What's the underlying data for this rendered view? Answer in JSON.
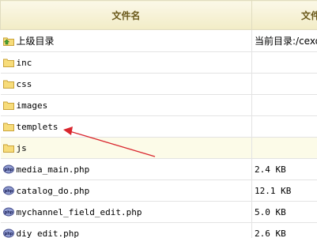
{
  "header": {
    "name_col": "文件名",
    "second_col": "文件"
  },
  "parent_row": {
    "label": "上级目录",
    "current_dir": "当前目录:/cexo"
  },
  "folders": [
    {
      "name": "inc"
    },
    {
      "name": "css"
    },
    {
      "name": "images"
    },
    {
      "name": "templets"
    },
    {
      "name": "js"
    }
  ],
  "files": [
    {
      "name": "media_main.php",
      "size": "2.4 KB"
    },
    {
      "name": "catalog_do.php",
      "size": "12.1 KB"
    },
    {
      "name": "mychannel_field_edit.php",
      "size": "5.0 KB"
    },
    {
      "name": "diy_edit.php",
      "size": "2.6 KB"
    }
  ],
  "icons": {
    "folder": "folder-icon",
    "php": "php-file-icon",
    "up": "parent-folder-icon"
  },
  "colors": {
    "header_text": "#6b5a1c",
    "arrow": "#d9262e",
    "highlight_row": "#fcfbe8"
  }
}
